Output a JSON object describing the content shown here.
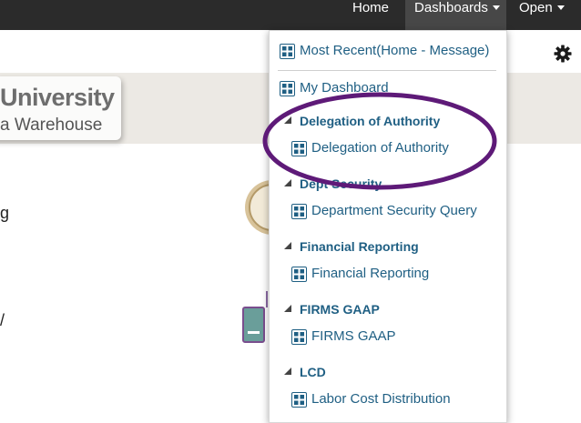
{
  "nav": {
    "home": "Home",
    "dashboards": "Dashboards",
    "open": "Open"
  },
  "banner": {
    "title": "University",
    "subtitle": "a Warehouse"
  },
  "partial_text": {
    "line1": "g",
    "line2": "/"
  },
  "menu": {
    "most_recent": "Most Recent(Home - Message)",
    "my_dashboard": "My Dashboard",
    "groups": [
      {
        "header": "Delegation of Authority",
        "item": "Delegation of Authority"
      },
      {
        "header": "Dept Security",
        "item": "Department Security Query"
      },
      {
        "header": "Financial Reporting",
        "item": "Financial Reporting"
      },
      {
        "header": "FIRMS GAAP",
        "item": "FIRMS GAAP"
      },
      {
        "header": "LCD",
        "item": "Labor Cost Distribution"
      }
    ]
  },
  "colors": {
    "nav_bg": "#2b2b2b",
    "menu_text": "#1f5f83",
    "highlight": "#5e1a78"
  }
}
